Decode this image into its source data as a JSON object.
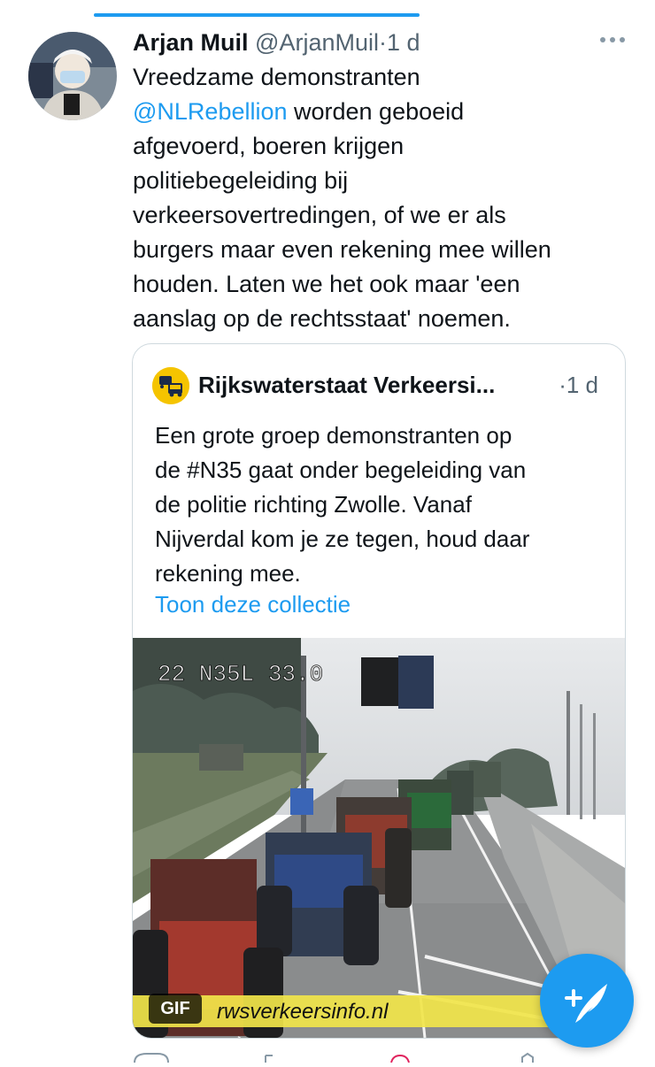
{
  "tweet": {
    "author_name": "Arjan Muil",
    "handle": "@ArjanMuil",
    "separator": "·",
    "time": "1 d",
    "text_lines": [
      {
        "mention": "",
        "text": "Vreedzame demonstranten"
      },
      {
        "mention": "@NLRebellion",
        "text": " worden geboeid"
      },
      {
        "mention": "",
        "text": "afgevoerd, boeren krijgen"
      },
      {
        "mention": "",
        "text": "politiebegeleiding bij"
      },
      {
        "mention": "",
        "text": "verkeersovertredingen, of we er als"
      },
      {
        "mention": "",
        "text": "burgers maar even rekening mee willen"
      },
      {
        "mention": "",
        "text": "houden. Laten we het ook maar 'een"
      },
      {
        "mention": "",
        "text": "aanslag op de rechtsstaat' noemen."
      }
    ]
  },
  "quoted": {
    "author_name": "Rijkswaterstaat Verkeersi...",
    "time": "·1 d",
    "text_lines": [
      "Een grote groep demonstranten op",
      "de #N35 gaat onder begeleiding van",
      "de politie richting Zwolle. Vanaf",
      "Nijverdal kom je ze tegen, houd daar",
      "rekening mee."
    ],
    "link_label": "Toon deze collectie",
    "media": {
      "overlay_text": "22 N35L 33.0",
      "watermark": "rwsverkeersinfo.nl",
      "badge": "GIF"
    }
  },
  "colors": {
    "accent": "#1d9bf0",
    "text": "#0f1419",
    "muted": "#536471",
    "border": "#cfd9de"
  },
  "icons": [
    "more-icon",
    "rijkswaterstaat-icon",
    "compose-icon"
  ]
}
